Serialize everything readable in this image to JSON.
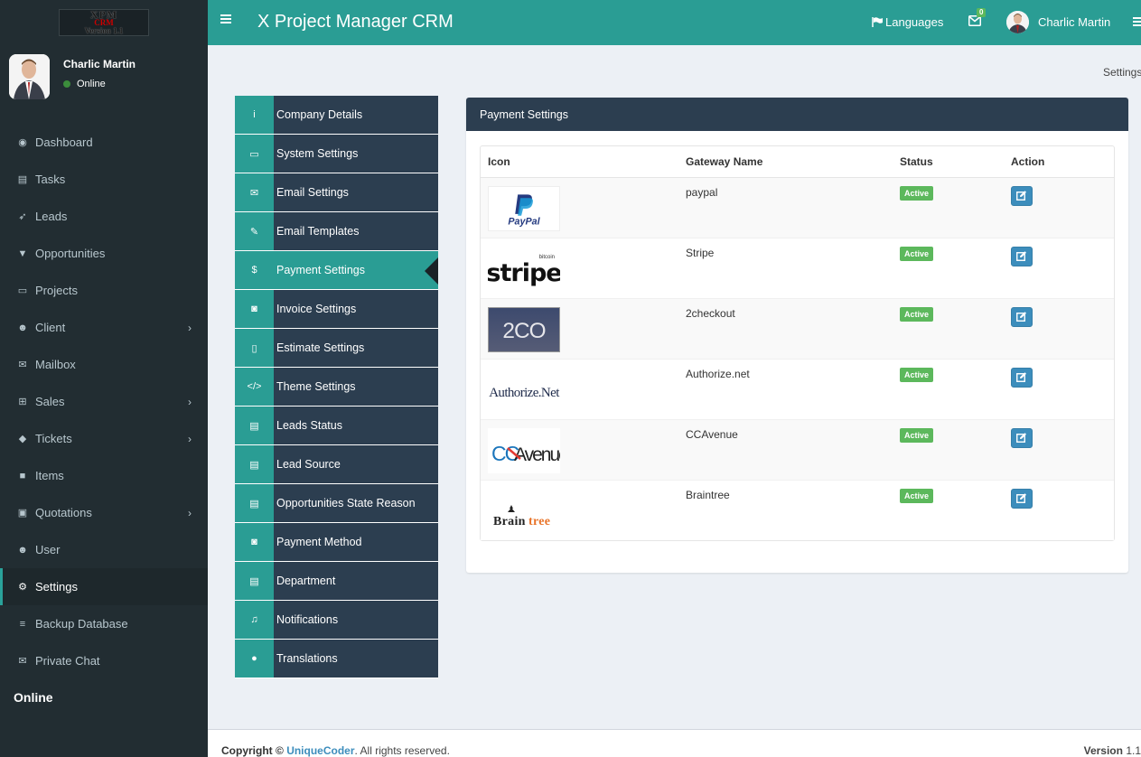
{
  "logo": {
    "line1": "XPM",
    "line2": "CRM",
    "line3": "Version 1.1"
  },
  "user": {
    "name": "Charlic Martin",
    "status": "Online"
  },
  "sidebar": {
    "items": [
      {
        "label": "Dashboard",
        "icon": "dashboard-icon",
        "glyph": "◉",
        "chevron": false
      },
      {
        "label": "Tasks",
        "icon": "tasks-icon",
        "glyph": "▤",
        "chevron": false
      },
      {
        "label": "Leads",
        "icon": "rocket-icon",
        "glyph": "➶",
        "chevron": false
      },
      {
        "label": "Opportunities",
        "icon": "filter-icon",
        "glyph": "▼",
        "chevron": false
      },
      {
        "label": "Projects",
        "icon": "folder-icon",
        "glyph": "▭",
        "chevron": false
      },
      {
        "label": "Client",
        "icon": "users-icon",
        "glyph": "☻",
        "chevron": true
      },
      {
        "label": "Mailbox",
        "icon": "envelope-icon",
        "glyph": "✉",
        "chevron": false
      },
      {
        "label": "Sales",
        "icon": "cart-icon",
        "glyph": "⊞",
        "chevron": true
      },
      {
        "label": "Tickets",
        "icon": "ticket-icon",
        "glyph": "◆",
        "chevron": true
      },
      {
        "label": "Items",
        "icon": "cube-icon",
        "glyph": "■",
        "chevron": false
      },
      {
        "label": "Quotations",
        "icon": "copy-icon",
        "glyph": "▣",
        "chevron": true
      },
      {
        "label": "User",
        "icon": "users-icon",
        "glyph": "☻",
        "chevron": false
      },
      {
        "label": "Settings",
        "icon": "cogs-icon",
        "glyph": "⚙",
        "chevron": false
      },
      {
        "label": "Backup Database",
        "icon": "database-icon",
        "glyph": "≡",
        "chevron": false
      },
      {
        "label": "Private Chat",
        "icon": "envelope-icon",
        "glyph": "✉",
        "chevron": false
      }
    ],
    "active_index": 12,
    "online_label": "Online"
  },
  "header": {
    "title": "X Project Manager CRM",
    "languages": "Languages",
    "mail_count": "0",
    "user_name": "Charlic Martin"
  },
  "breadcrumb": "Settings",
  "settings_nav": {
    "items": [
      {
        "label": "Company Details",
        "icon": "info-icon",
        "glyph": "i"
      },
      {
        "label": "System Settings",
        "icon": "desktop-icon",
        "glyph": "▭"
      },
      {
        "label": "Email Settings",
        "icon": "envelope-icon",
        "glyph": "✉"
      },
      {
        "label": "Email Templates",
        "icon": "edit-icon",
        "glyph": "✎"
      },
      {
        "label": "Payment Settings",
        "icon": "dollar-icon",
        "glyph": "$"
      },
      {
        "label": "Invoice Settings",
        "icon": "money-icon",
        "glyph": "◙"
      },
      {
        "label": "Estimate Settings",
        "icon": "file-icon",
        "glyph": "▯"
      },
      {
        "label": "Theme Settings",
        "icon": "code-icon",
        "glyph": "</>"
      },
      {
        "label": "Leads Status",
        "icon": "list-icon",
        "glyph": "▤"
      },
      {
        "label": "Lead Source",
        "icon": "list-icon",
        "glyph": "▤"
      },
      {
        "label": "Opportunities State Reason",
        "icon": "list-icon",
        "glyph": "▤"
      },
      {
        "label": "Payment Method",
        "icon": "money-icon",
        "glyph": "◙"
      },
      {
        "label": "Department",
        "icon": "list-icon",
        "glyph": "▤"
      },
      {
        "label": "Notifications",
        "icon": "bell-icon",
        "glyph": "♫"
      },
      {
        "label": "Translations",
        "icon": "globe-icon",
        "glyph": "●"
      }
    ],
    "active_index": 4
  },
  "panel": {
    "title": "Payment Settings",
    "columns": [
      "Icon",
      "Gateway Name",
      "Status",
      "Action"
    ],
    "rows": [
      {
        "logo": "paypal-logo",
        "name": "paypal",
        "status": "Active"
      },
      {
        "logo": "stripe-logo",
        "name": "Stripe",
        "status": "Active"
      },
      {
        "logo": "2checkout-logo",
        "name": "2checkout",
        "status": "Active"
      },
      {
        "logo": "authorize-net-logo",
        "name": "Authorize.net",
        "status": "Active"
      },
      {
        "logo": "ccavenue-logo",
        "name": "CCAvenue",
        "status": "Active"
      },
      {
        "logo": "braintree-logo",
        "name": "Braintree",
        "status": "Active"
      }
    ],
    "logo_text": {
      "paypal": "PayPal",
      "stripe": "stripe",
      "stripe_bitcoin": "bitcoin",
      "twoco": "2CO",
      "authorize": "Authorize.Net",
      "ccavenue_cc": "CC",
      "ccavenue_avenue": "Avenue",
      "braintree_brain": "Brain",
      "braintree_tree": "tree"
    }
  },
  "footer": {
    "copyright_prefix": "Copyright ©",
    "company": "UniqueCoder",
    "suffix": ". All rights reserved.",
    "version_label": "Version",
    "version_number": "1.1"
  }
}
